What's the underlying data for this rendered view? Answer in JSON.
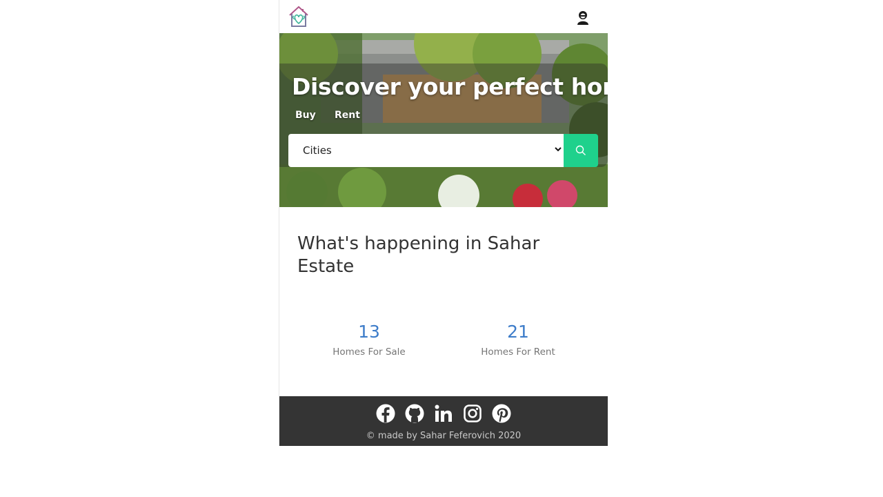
{
  "header": {
    "logo": "house-logo-icon",
    "user": "user-avatar-icon"
  },
  "hero": {
    "title": "Discover your perfect home",
    "tabs": [
      {
        "label": "Buy"
      },
      {
        "label": "Rent"
      }
    ],
    "select_value": "Cities",
    "search_icon": "search-icon"
  },
  "stats": {
    "title": "What's happening in Sahar Estate",
    "items": [
      {
        "value": "13",
        "label": "Homes For Sale"
      },
      {
        "value": "21",
        "label": "Homes For Rent"
      }
    ]
  },
  "footer": {
    "icons": [
      "facebook-icon",
      "github-icon",
      "linkedin-icon",
      "instagram-icon",
      "pinterest-icon"
    ],
    "credit": "© made by Sahar Feferovich 2020"
  },
  "colors": {
    "accent": "#1fd18c",
    "stat_number": "#3d7cc9",
    "footer_bg": "#343434"
  }
}
